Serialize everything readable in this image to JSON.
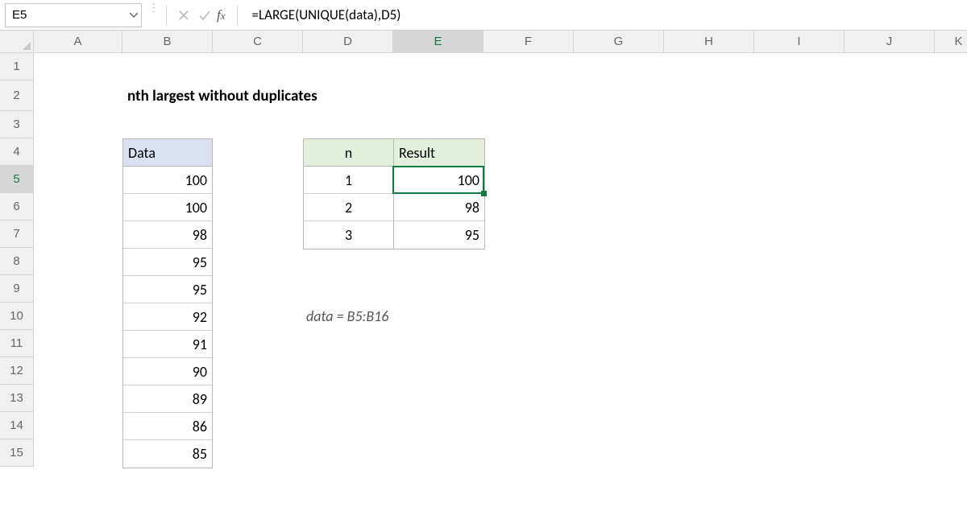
{
  "namebox": {
    "value": "E5"
  },
  "formula": "=LARGE(UNIQUE(data),D5)",
  "columns": [
    "A",
    "B",
    "C",
    "D",
    "E",
    "F",
    "G",
    "H",
    "I",
    "J",
    "K"
  ],
  "rows": [
    "1",
    "2",
    "3",
    "4",
    "5",
    "6",
    "7",
    "8",
    "9",
    "10",
    "11",
    "12",
    "13",
    "14",
    "15"
  ],
  "activeCol": "E",
  "activeRow": "5",
  "title": "nth largest without duplicates",
  "dataHeader": "Data",
  "dataValues": [
    "100",
    "100",
    "98",
    "95",
    "95",
    "92",
    "91",
    "90",
    "89",
    "86",
    "85"
  ],
  "resHeaders": {
    "n": "n",
    "r": "Result"
  },
  "resRows": [
    {
      "n": "1",
      "v": "100"
    },
    {
      "n": "2",
      "v": "98"
    },
    {
      "n": "3",
      "v": "95"
    }
  ],
  "note": "data = B5:B16"
}
